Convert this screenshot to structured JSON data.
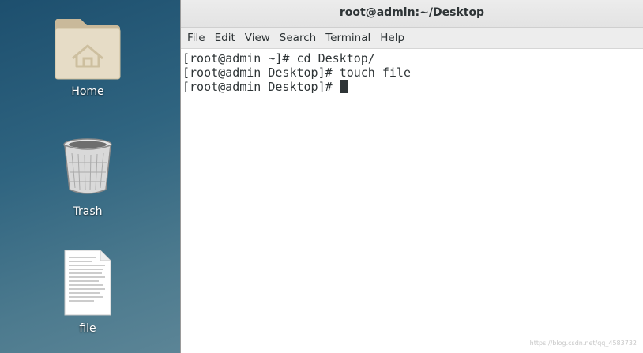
{
  "desktop": {
    "icons": [
      {
        "label": "Home",
        "icon": "home-folder-icon"
      },
      {
        "label": "Trash",
        "icon": "trash-icon"
      },
      {
        "label": "file",
        "icon": "text-file-icon"
      }
    ]
  },
  "window": {
    "title": "root@admin:~/Desktop",
    "menu": [
      "File",
      "Edit",
      "View",
      "Search",
      "Terminal",
      "Help"
    ],
    "terminal_lines": [
      "[root@admin ~]# cd Desktop/",
      "[root@admin Desktop]# touch file",
      "[root@admin Desktop]# "
    ]
  },
  "watermark": "https://blog.csdn.net/qq_4583732",
  "colors": {
    "desktop_bg": "#2f6480",
    "titlebar_bg": "#e8e8e8",
    "menubar_bg": "#ededed",
    "terminal_bg": "#ffffff",
    "terminal_fg": "#2e3436"
  }
}
